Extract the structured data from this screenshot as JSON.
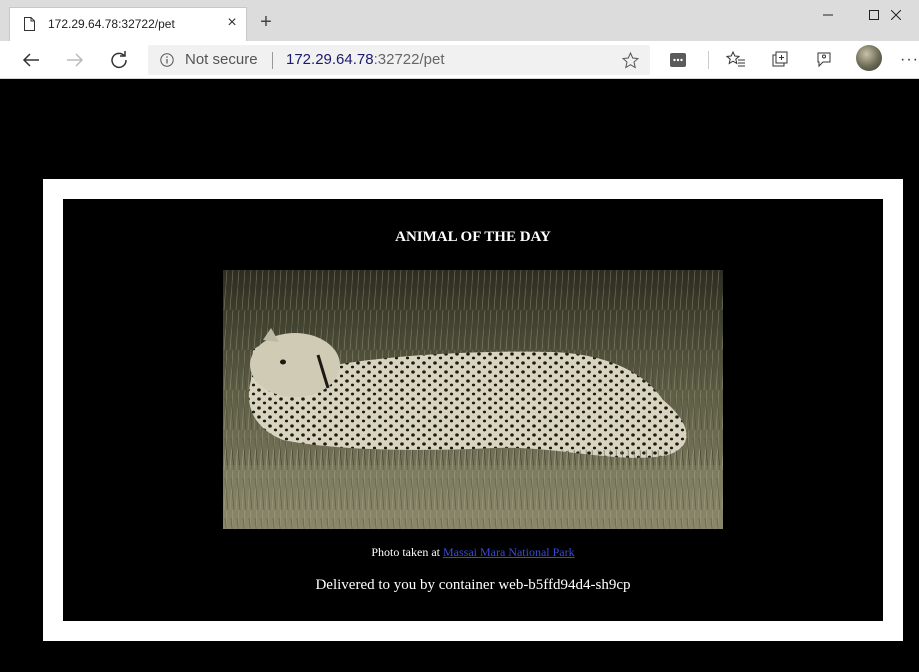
{
  "browser": {
    "tab_title": "172.29.64.78:32722/pet",
    "security_label": "Not secure",
    "url_host": "172.29.64.78",
    "url_rest": ":32722/pet"
  },
  "page": {
    "heading": "ANIMAL OF THE DAY",
    "photo_prefix": "Photo taken at",
    "photo_link": "Massai Mara National Park",
    "delivered": "Delivered to you by container web-b5ffd94d4-sh9cp"
  },
  "colors": {
    "page_background": "#000000",
    "frame": "#ffffff",
    "link": "#3a4ad8"
  }
}
